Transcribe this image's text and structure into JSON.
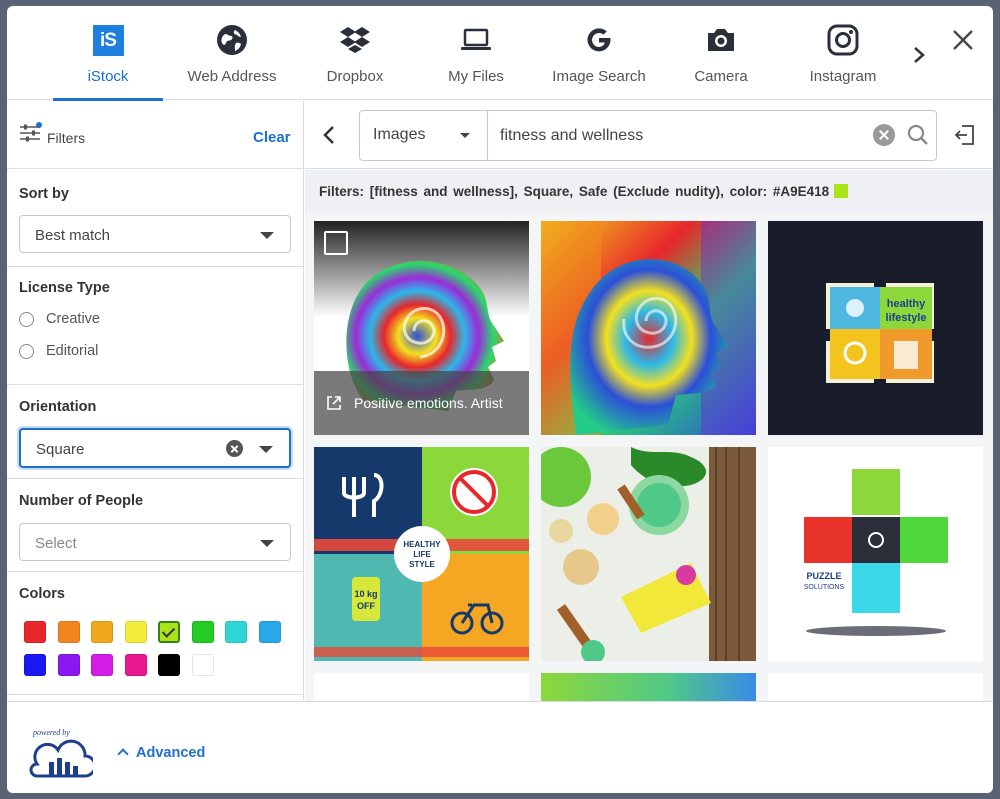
{
  "tabs": [
    {
      "label": "iStock",
      "icon": "istock-logo-icon",
      "logo_text": "iS",
      "active": true
    },
    {
      "label": "Web Address",
      "icon": "globe-icon"
    },
    {
      "label": "Dropbox",
      "icon": "dropbox-icon"
    },
    {
      "label": "My Files",
      "icon": "laptop-icon"
    },
    {
      "label": "Image Search",
      "icon": "google-g-icon"
    },
    {
      "label": "Camera",
      "icon": "camera-icon"
    },
    {
      "label": "Instagram",
      "icon": "instagram-icon"
    }
  ],
  "sidebar": {
    "filters_label": "Filters",
    "clear_label": "Clear",
    "sort": {
      "title": "Sort by",
      "value": "Best match"
    },
    "license": {
      "title": "License Type",
      "options": [
        "Creative",
        "Editorial"
      ]
    },
    "orientation": {
      "title": "Orientation",
      "value": "Square"
    },
    "people": {
      "title": "Number of People",
      "placeholder": "Select"
    },
    "colors": {
      "title": "Colors",
      "swatches": [
        "#e8262b",
        "#f0861d",
        "#f0a71b",
        "#f2ee3b",
        "#a9e418",
        "#22cc22",
        "#2ed6d6",
        "#27a9e8",
        "#1818f0",
        "#8a18f0",
        "#d41be8",
        "#e8188e",
        "#000000",
        "#ffffff"
      ],
      "selected": "#a9e418"
    }
  },
  "search": {
    "type_value": "Images",
    "query": "fitness and wellness"
  },
  "filter_summary": {
    "label": "Filters:",
    "text": "[fitness and wellness],  Square,  Safe (Exclude nudity),  color: #A9E418",
    "chip_color": "#a9e418"
  },
  "results": [
    {
      "caption": "Positive emotions. Artist"
    },
    {
      "caption": ""
    },
    {
      "caption": "",
      "text_lines": [
        "healthy",
        "lifestyle"
      ]
    },
    {
      "caption": "",
      "text_lines": [
        "HEALTHY",
        "LIFE",
        "STYLE",
        "10 kg",
        "OFF"
      ]
    },
    {
      "caption": ""
    },
    {
      "caption": "",
      "text_lines": [
        "PUZZLE",
        "SOLUTIONS"
      ]
    }
  ],
  "footer": {
    "powered_by": "powered by",
    "advanced_label": "Advanced"
  },
  "colors": {
    "accent": "#1d6fd1"
  }
}
